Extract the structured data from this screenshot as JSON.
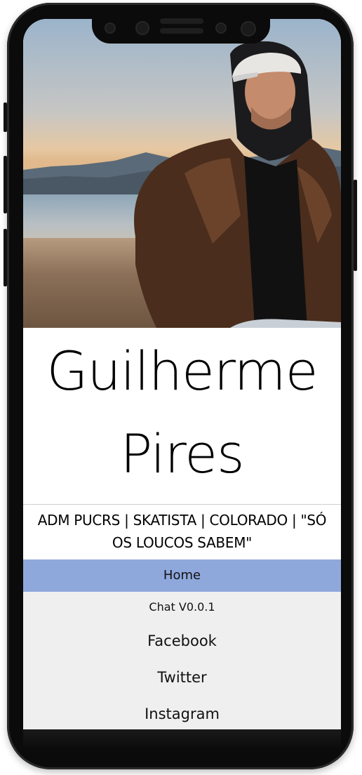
{
  "profile": {
    "first_name": "Guilherme",
    "last_name": "Pires",
    "bio": "ADM PUCRS | SKATISTA | COLORADO | \"SÓ OS LOUCOS SABEM\""
  },
  "nav": {
    "home": "Home",
    "chat": "Chat V0.0.1",
    "facebook": "Facebook",
    "twitter": "Twitter",
    "instagram": "Instagram"
  },
  "colors": {
    "nav_active": "#8fa8dc",
    "nav_background": "#efefef",
    "phone_frame": "#0b0b0b"
  },
  "hero": {
    "icon": "profile-photo"
  }
}
